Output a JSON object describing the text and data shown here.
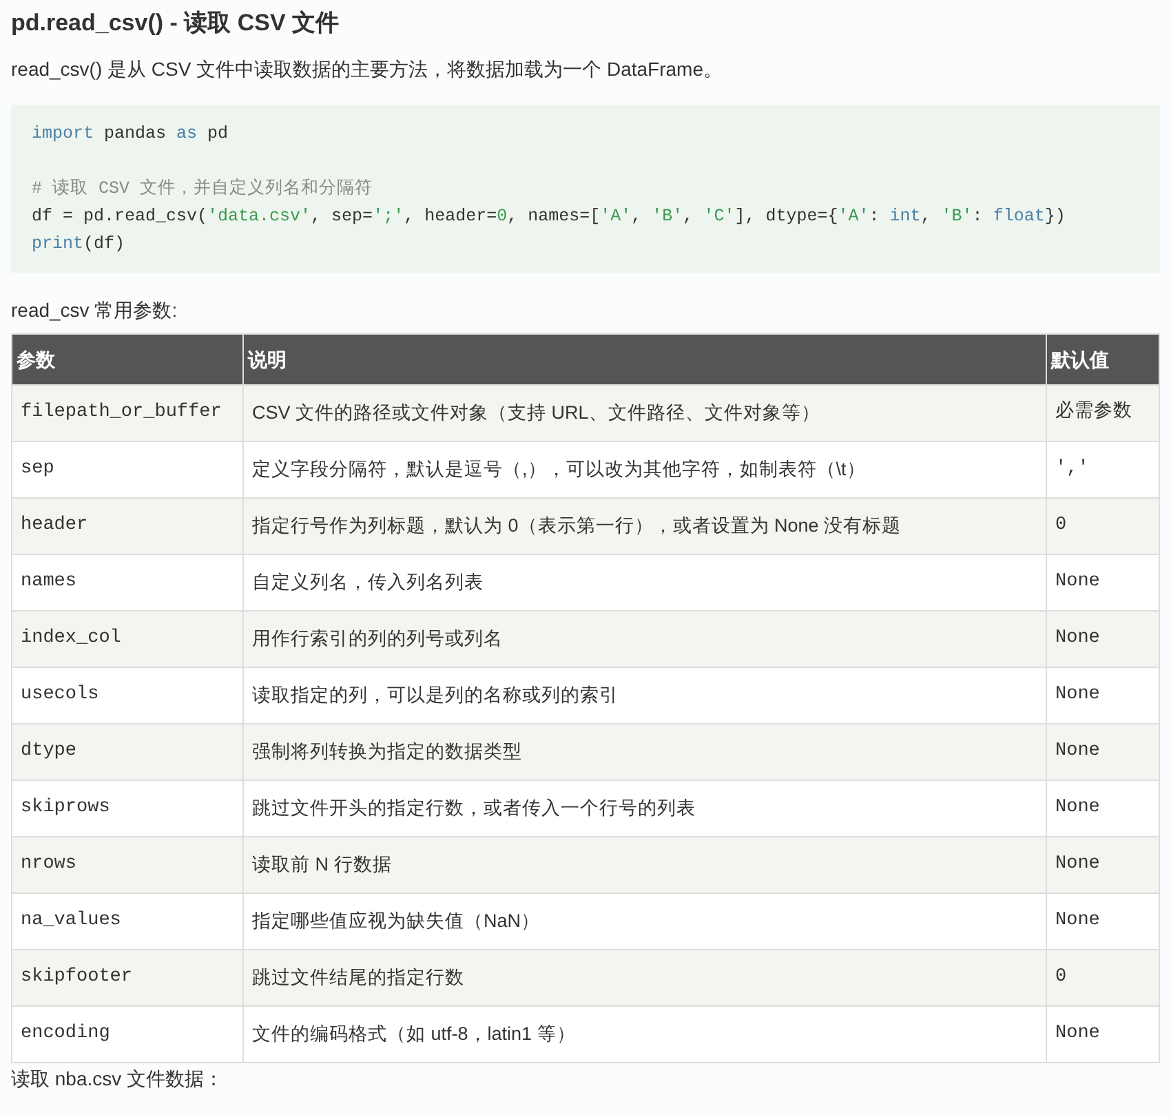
{
  "title": "pd.read_csv() - 读取 CSV 文件",
  "intro": "read_csv() 是从 CSV 文件中读取数据的主要方法，将数据加载为一个 DataFrame。",
  "code_lines": [
    [
      {
        "text": "import",
        "kind": "keyword"
      },
      {
        "text": " pandas ",
        "kind": "plain"
      },
      {
        "text": "as",
        "kind": "keyword"
      },
      {
        "text": " pd",
        "kind": "plain"
      }
    ],
    [
      {
        "text": "# 读取 CSV 文件，并自定义列名和分隔符",
        "kind": "comment"
      }
    ],
    [
      {
        "text": "df = pd.read_csv(",
        "kind": "plain"
      },
      {
        "text": "'data.csv'",
        "kind": "string"
      },
      {
        "text": ", sep=",
        "kind": "plain"
      },
      {
        "text": "';'",
        "kind": "string"
      },
      {
        "text": ", header=",
        "kind": "plain"
      },
      {
        "text": "0",
        "kind": "string"
      },
      {
        "text": ", names=[",
        "kind": "plain"
      },
      {
        "text": "'A'",
        "kind": "string"
      },
      {
        "text": ", ",
        "kind": "plain"
      },
      {
        "text": "'B'",
        "kind": "string"
      },
      {
        "text": ", ",
        "kind": "plain"
      },
      {
        "text": "'C'",
        "kind": "string"
      },
      {
        "text": "], dtype={",
        "kind": "plain"
      },
      {
        "text": "'A'",
        "kind": "string"
      },
      {
        "text": ": ",
        "kind": "plain"
      },
      {
        "text": "int",
        "kind": "keyword"
      },
      {
        "text": ", ",
        "kind": "plain"
      },
      {
        "text": "'B'",
        "kind": "string"
      },
      {
        "text": ": ",
        "kind": "plain"
      },
      {
        "text": "float",
        "kind": "keyword"
      },
      {
        "text": "})",
        "kind": "plain"
      }
    ],
    [
      {
        "text": "print",
        "kind": "keyword"
      },
      {
        "text": "(df)",
        "kind": "plain"
      }
    ]
  ],
  "table_caption": "read_csv 常用参数:",
  "table": {
    "columns": [
      "参数",
      "说明",
      "默认值"
    ],
    "rows": [
      [
        "filepath_or_buffer",
        "CSV 文件的路径或文件对象（支持 URL、文件路径、文件对象等）",
        "必需参数"
      ],
      [
        "sep",
        "定义字段分隔符，默认是逗号（,），可以改为其他字符，如制表符（\\t）",
        "','"
      ],
      [
        "header",
        "指定行号作为列标题，默认为 0（表示第一行），或者设置为 None 没有标题",
        "0"
      ],
      [
        "names",
        "自定义列名，传入列名列表",
        "None"
      ],
      [
        "index_col",
        "用作行索引的列的列号或列名",
        "None"
      ],
      [
        "usecols",
        "读取指定的列，可以是列的名称或列的索引",
        "None"
      ],
      [
        "dtype",
        "强制将列转换为指定的数据类型",
        "None"
      ],
      [
        "skiprows",
        "跳过文件开头的指定行数，或者传入一个行号的列表",
        "None"
      ],
      [
        "nrows",
        "读取前 N 行数据",
        "None"
      ],
      [
        "na_values",
        "指定哪些值应视为缺失值（NaN）",
        "None"
      ],
      [
        "skipfooter",
        "跳过文件结尾的指定行数",
        "0"
      ],
      [
        "encoding",
        "文件的编码格式（如 utf-8，latin1 等）",
        "None"
      ]
    ]
  },
  "footer_text": "读取 nba.csv 文件数据："
}
